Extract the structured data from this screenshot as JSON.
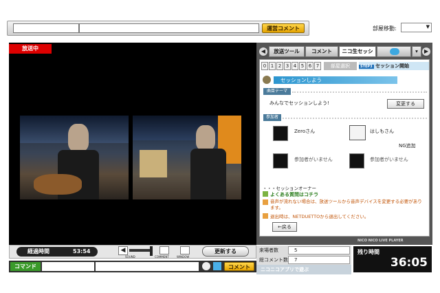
{
  "header": {
    "room_label": "部屋移動:",
    "jump_label": "運営コメント"
  },
  "player": {
    "on_air": "放送中",
    "elapsed_label": "経過時間",
    "elapsed_value": "53:54",
    "sound": "SOUND",
    "comment": "COMMENT",
    "window": "WINDOW",
    "refresh": "更新する",
    "command": "コマンド",
    "comment_btn": "コメント"
  },
  "panel": {
    "tabs": [
      "放送ツール",
      "コメント",
      "ニコ生セッション",
      "",
      "▾"
    ],
    "steps": [
      "0",
      "1",
      "2",
      "3",
      "4",
      "5",
      "6",
      "7"
    ],
    "step_label": "部屋選択",
    "step3": "STEP3",
    "session_start": "セッション開始",
    "session_banner": "セッションしよう",
    "theme_label": "曲目テーマ",
    "theme_text": "みんなでセッションしよう!",
    "change_btn": "変更する",
    "participants_label": "参加者",
    "participants": [
      {
        "name": "Zeroさん",
        "ng": ""
      },
      {
        "name": "はしもさん",
        "ng": "NG追加"
      },
      {
        "name": "参加者がいません",
        "ng": ""
      },
      {
        "name": "参加者がいません",
        "ng": ""
      }
    ],
    "owner": "・・・セッションオーナー",
    "faq": "よくある質問はコチラ",
    "note1": "音声が流れない場合は、放送ツールから音声デバイスを変更する必要があります。",
    "note2": "退出時は、NETDUETTOから退出してください。",
    "back_btn": "←戻る",
    "brand": "NICO NICO LIVE PLAYER"
  },
  "stats": {
    "visitors_label": "来場者数",
    "visitors": "5",
    "comments_label": "総コメント数",
    "comments": "7",
    "app_label": "ニコニコアプリで遊ぶ",
    "remain_label": "残り時間",
    "remain": "36:05"
  }
}
